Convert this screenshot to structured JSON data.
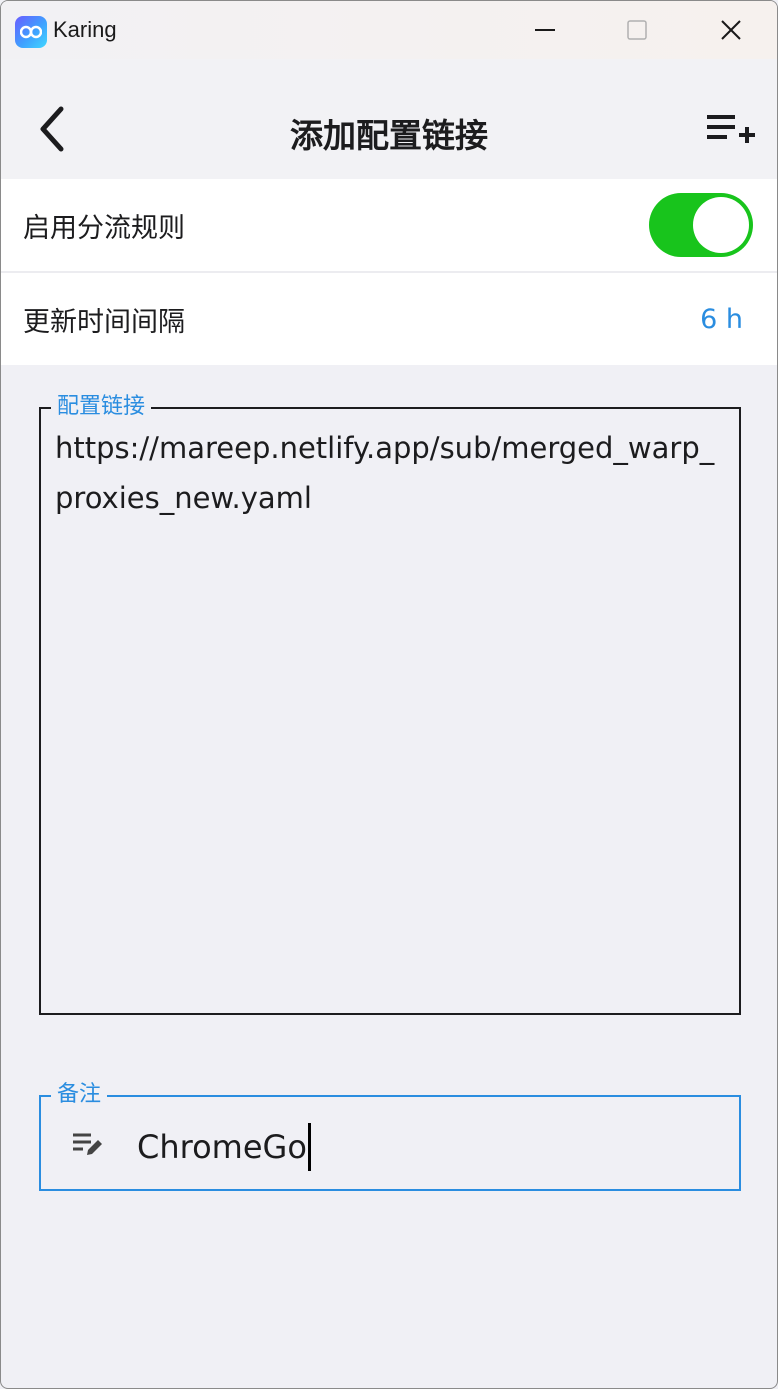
{
  "window": {
    "app_title": "Karing"
  },
  "header": {
    "title": "添加配置链接"
  },
  "settings": {
    "routing_rules_label": "启用分流规则",
    "routing_rules_enabled": true,
    "update_interval_label": "更新时间间隔",
    "update_interval_value": "6 h"
  },
  "url_field": {
    "label": "配置链接",
    "value": "https://mareep.netlify.app/sub/merged_warp_proxies_new.yaml"
  },
  "note_field": {
    "label": "备注",
    "value": "ChromeGo"
  },
  "colors": {
    "accent": "#2a8de0",
    "toggle_on": "#18c41c"
  },
  "icons": {
    "back": "chevron-left-icon",
    "add": "playlist-add-icon",
    "note": "edit-note-icon"
  }
}
